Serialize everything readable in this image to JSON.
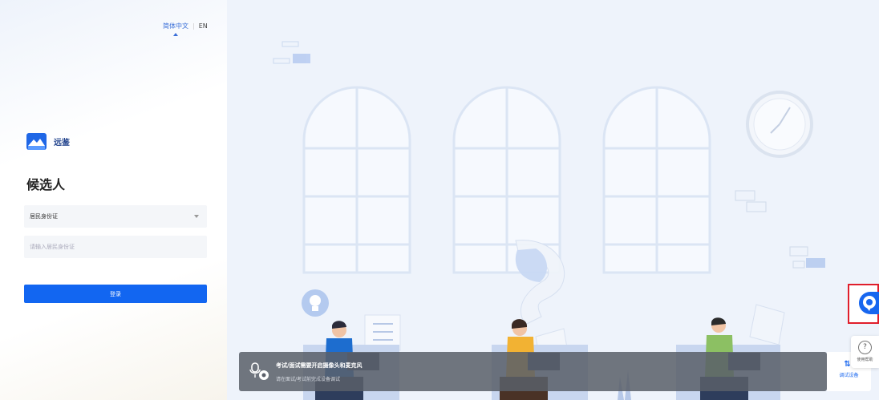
{
  "language": {
    "chinese": "简体中文",
    "english": "EN"
  },
  "brand": {
    "name": "远鉴"
  },
  "form": {
    "role_title": "候选人",
    "id_type": "居民身份证",
    "id_placeholder": "请输入居民身份证",
    "login_label": "登录"
  },
  "notice": {
    "title": "考试/面试需要开启摄像头和麦克风",
    "subtitle": "请在面试/考试前完成设备调试"
  },
  "widgets": {
    "help_label": "使用帮助",
    "device_label": "调试设备"
  },
  "colors": {
    "primary": "#1266f1",
    "brand_dark": "#1d3f8a",
    "highlight_frame": "#e01e2b"
  }
}
